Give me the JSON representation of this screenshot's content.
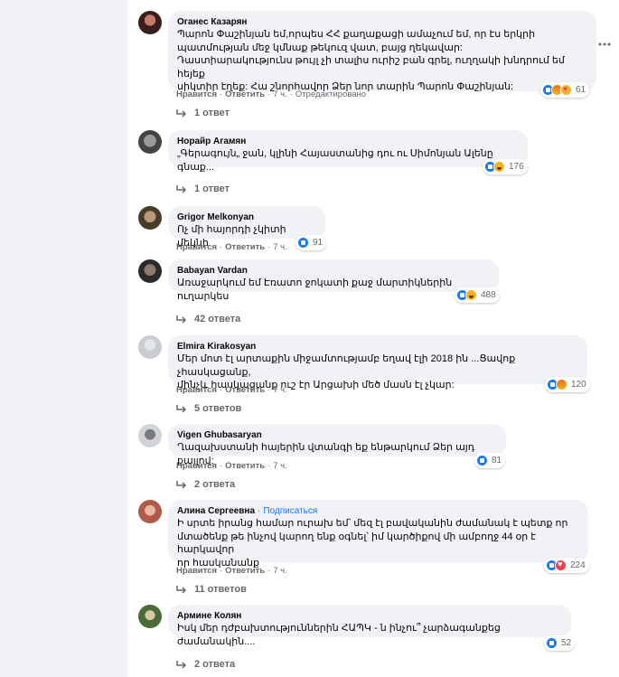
{
  "labels": {
    "like": "Нравится",
    "reply": "Ответить",
    "time": "7 ч.",
    "edited": "Отредактировано",
    "subscribe": "Подписаться",
    "dot": "·"
  },
  "colors": {
    "like_blue": "#1877f2",
    "text_gray": "#65676b",
    "bubble_bg": "#f0f2f5"
  },
  "comments": [
    {
      "author": "Оганес Казарян",
      "text": "Պարոն Փաշինյան եմ,որպես ՀՀ քաղաքացի ամաչում եմ, որ էս երկրի\nպատմության մեջ կմնաք թեկուզ վատ, բայց ղեկավար:\nԴաստիարակությունս թույլ չի տալիս ուրիշ բան գրել, ուղղակի խնդրում եմ հեյեք\nսիկտիր էղեք: Հա շնորհավոր Ձեր նոր տարին Պարոն Փաշինյան:",
      "reactions": [
        "like",
        "angry",
        "care"
      ],
      "reaction_count": "61",
      "edited": true,
      "replies": "1 ответ"
    },
    {
      "author": "Норайр Агамян",
      "text": "„Գերագույն„ ջան, կլինի Հայաստանից դու ու Սիմոնյան Ալենը գնաք...",
      "reactions": [
        "like",
        "haha"
      ],
      "reaction_count": "176",
      "replies": "1 ответ"
    },
    {
      "author": "Grigor Melkonyan",
      "text": "Ոչ մի հայորդի չկիտի մեկնի",
      "reactions": [
        "like"
      ],
      "reaction_count": "91",
      "replies": ""
    },
    {
      "author": "Babayan Vardan",
      "text": "Առաջարկում եմ Էռատո ջոկատի քաջ մարտիկներին ուղարկես",
      "reactions": [
        "like",
        "haha"
      ],
      "reaction_count": "488",
      "replies": "42 ответа"
    },
    {
      "author": "Elmira Kirakosyan",
      "text": "Մեր մոտ էլ արտաքին միջամտությամբ եղավ էլի 2018 ին ...Ցավոք չհասկացանք,\nմինչև հասկացանք ուշ էր Արցախի մեծ մասն էլ չկար:",
      "reactions": [
        "like",
        "angry"
      ],
      "reaction_count": "120",
      "replies": "5 ответов"
    },
    {
      "author": "Vigen Ghubasaryan",
      "text": "Ղազախստանի հայերին վտանգի եք ենթարկում Ձեր այդ քայլով:",
      "reactions": [
        "like"
      ],
      "reaction_count": "81",
      "replies": "2 ответа"
    },
    {
      "author": "Алина Сергеевна",
      "subscribe": true,
      "text": "Ի սրտե իրանց համար ուրախ եմ՝ մեզ էլ բավականին ժամանակ է պետք որ\nմտածենք թե ինչով կարող ենք օգնել՝ իմ կարծիքով մի ամբողջ 44 օր է հարկավոր\nոր հասկանանք",
      "reactions": [
        "like",
        "heart"
      ],
      "reaction_count": "224",
      "replies": "11 ответов"
    },
    {
      "author": "Армине Колян",
      "text": "Իսկ մեր դժբախտություններին ՀԱՊԿ - ն ինչու՞ չարձագանքեց ժամանակին....",
      "reactions": [
        "like"
      ],
      "reaction_count": "52",
      "replies": "2 ответа"
    }
  ]
}
